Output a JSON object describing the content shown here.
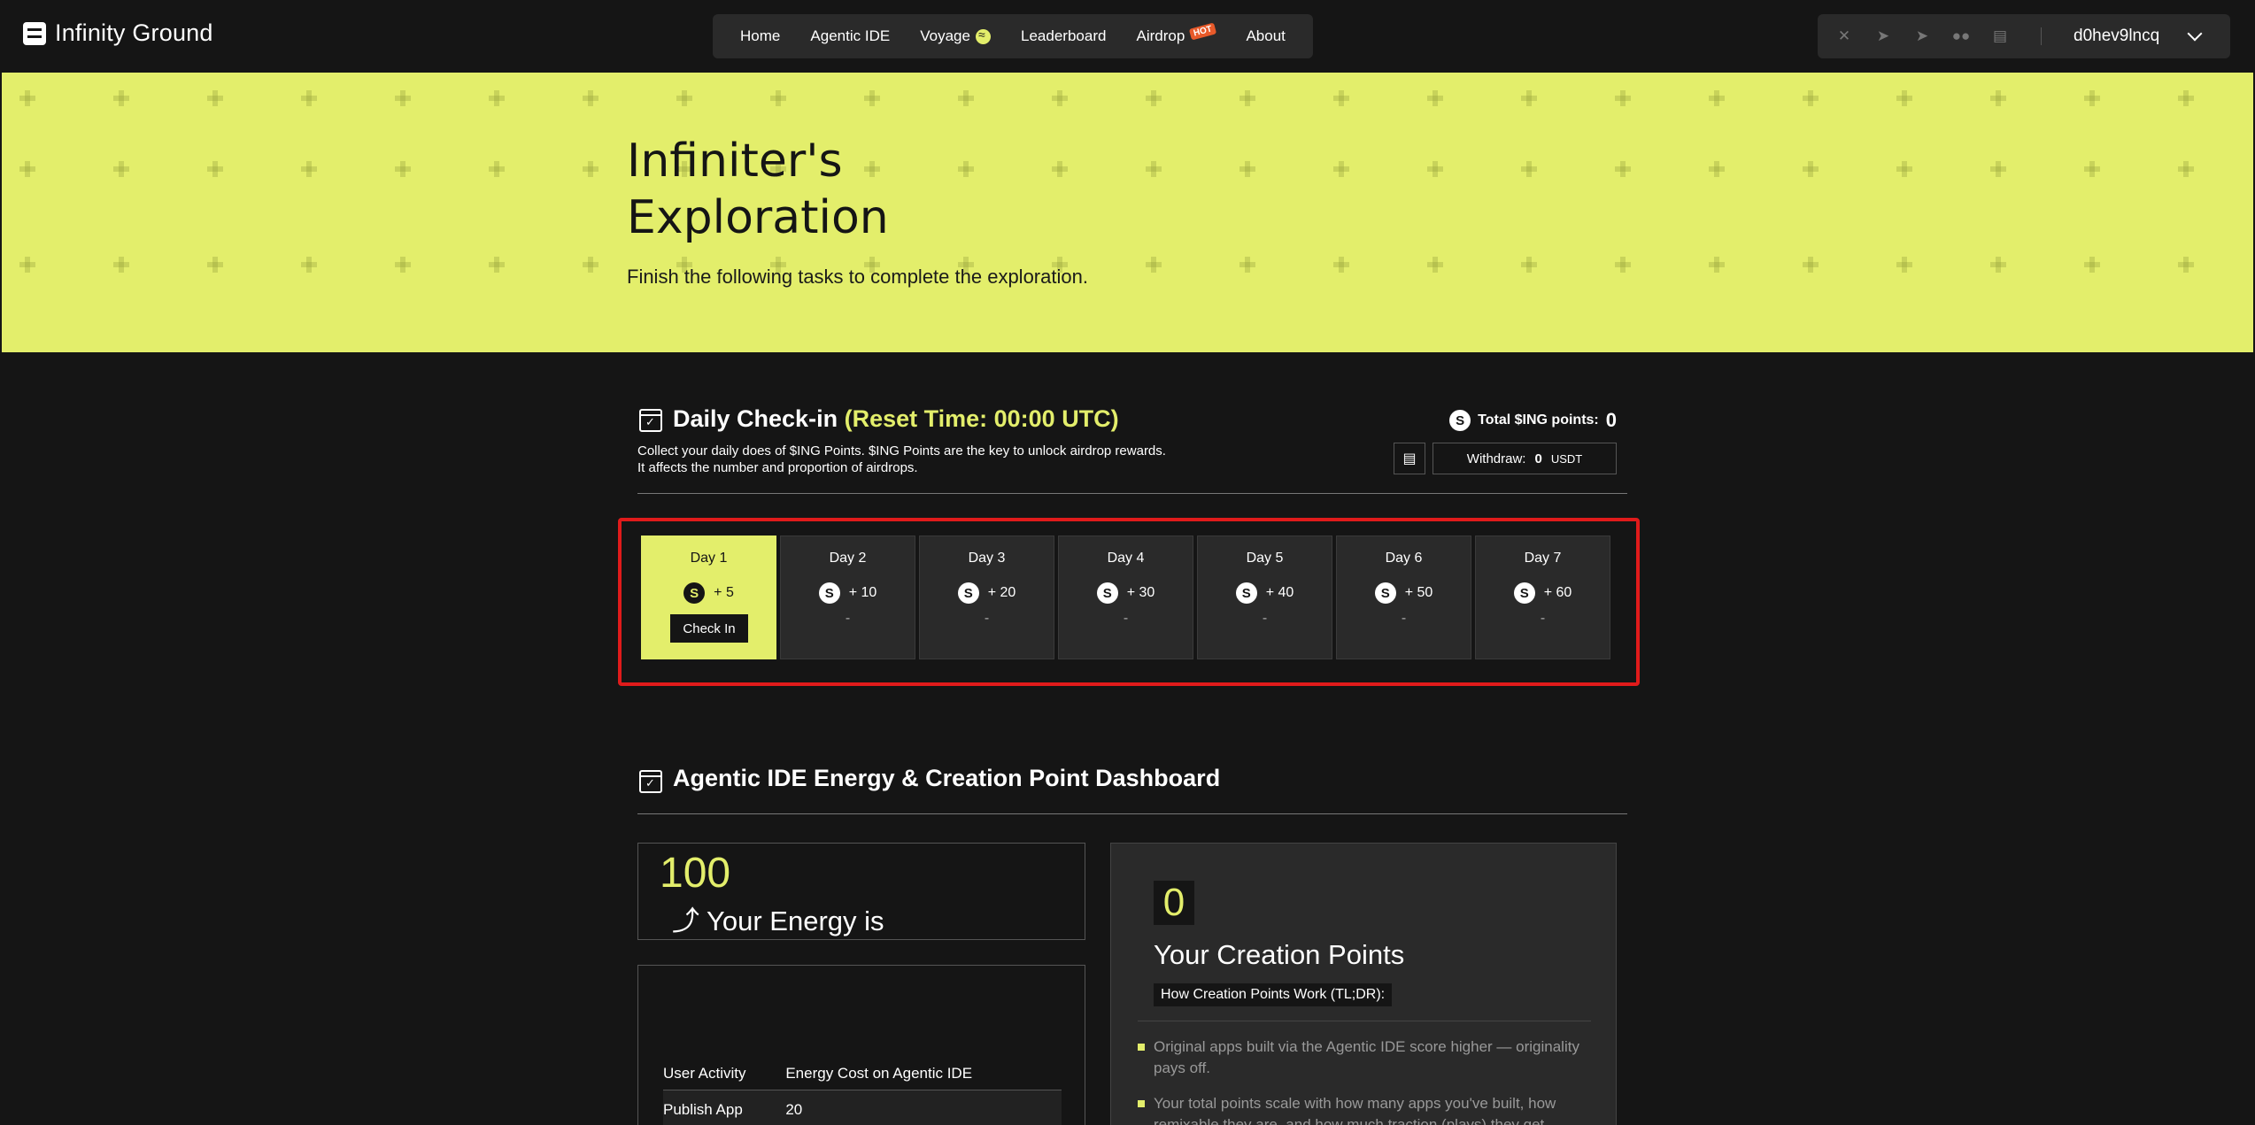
{
  "header": {
    "logo_text": "Infinity Ground",
    "nav": [
      {
        "label": "Home"
      },
      {
        "label": "Agentic IDE"
      },
      {
        "label": "Voyage"
      },
      {
        "label": "Leaderboard"
      },
      {
        "label": "Airdrop",
        "badge": "HOT"
      },
      {
        "label": "About"
      }
    ],
    "tools": [
      "x-icon",
      "telegram-icon",
      "telegram-icon",
      "medium-icon",
      "docs-icon"
    ],
    "username": "d0hev9lncq"
  },
  "hero": {
    "title_line1": "Infiniter's",
    "title_line2": "Exploration",
    "subtitle": "Finish the following tasks to complete the exploration."
  },
  "checkin": {
    "title": "Daily Check-in",
    "reset": "(Reset Time: 00:00 UTC)",
    "description": "Collect your daily does of $ING Points. $ING Points are the key to unlock airdrop rewards. It affects the number and proportion of airdrops.",
    "total_label": "Total $ING points:",
    "total_value": "0",
    "withdraw_label": "Withdraw:",
    "withdraw_amount": "0",
    "withdraw_unit": "USDT",
    "coin_symbol": "S",
    "check_in_label": "Check In",
    "days": [
      {
        "label": "Day 1",
        "reward": "+ 5",
        "status": ""
      },
      {
        "label": "Day 2",
        "reward": "+ 10",
        "status": "-"
      },
      {
        "label": "Day 3",
        "reward": "+ 20",
        "status": "-"
      },
      {
        "label": "Day 4",
        "reward": "+ 30",
        "status": "-"
      },
      {
        "label": "Day 5",
        "reward": "+ 40",
        "status": "-"
      },
      {
        "label": "Day 6",
        "reward": "+ 50",
        "status": "-"
      },
      {
        "label": "Day 7",
        "reward": "+ 60",
        "status": "-"
      }
    ]
  },
  "dashboard": {
    "title_part1": "Agentic IDE",
    "title_part2": "Energy",
    "title_part3": "&",
    "title_part4": "Creation Point",
    "title_part5": "Dashboard",
    "energy_value": "100",
    "energy_label": "⤴ Your Energy is",
    "table": {
      "headers": [
        "User Activity",
        "Energy Cost on Agentic IDE"
      ],
      "rows": [
        [
          "Publish App",
          "20"
        ]
      ]
    },
    "creation_value": "0",
    "creation_title": "Your Creation Points",
    "how_label": "How Creation Points Work (TL;DR):",
    "points": [
      "Original apps built via the Agentic IDE score higher — originality pays off.",
      "Your total points scale with how many apps you've built, how remixable they are, and how much traction (plays) they get."
    ]
  },
  "colors": {
    "accent": "#e3ee6b",
    "background": "#151515",
    "highlight_border": "#e01b1b"
  }
}
